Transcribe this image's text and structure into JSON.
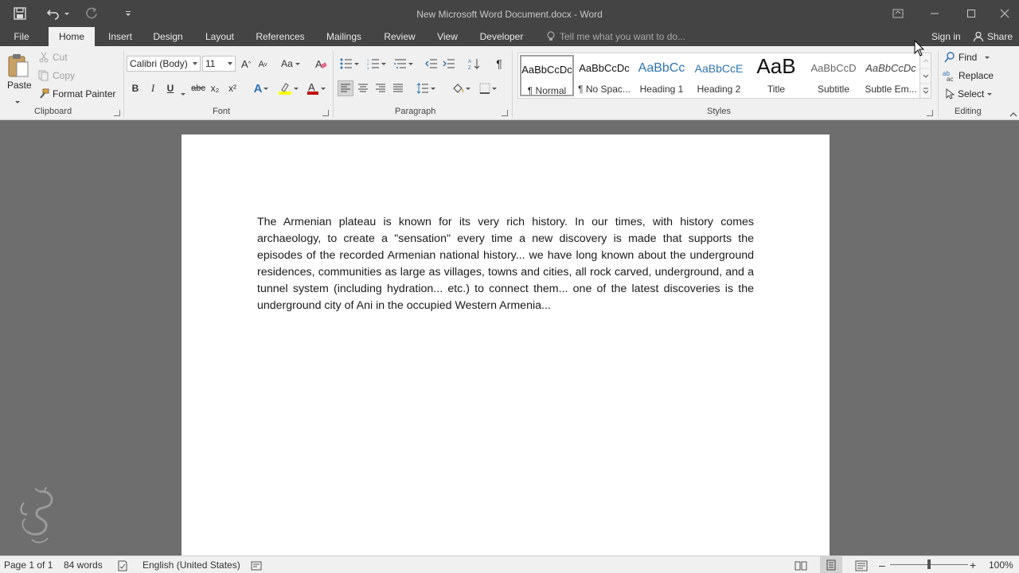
{
  "window": {
    "title": "New Microsoft Word Document.docx - Word"
  },
  "tabs": [
    {
      "label": "File"
    },
    {
      "label": "Home",
      "active": true
    },
    {
      "label": "Insert"
    },
    {
      "label": "Design"
    },
    {
      "label": "Layout"
    },
    {
      "label": "References"
    },
    {
      "label": "Mailings"
    },
    {
      "label": "Review"
    },
    {
      "label": "View"
    },
    {
      "label": "Developer"
    }
  ],
  "tell_me": {
    "placeholder": "Tell me what you want to do..."
  },
  "account": {
    "sign_in": "Sign in",
    "share": "Share"
  },
  "clipboard": {
    "paste": "Paste",
    "cut": "Cut",
    "copy": "Copy",
    "format_painter": "Format Painter",
    "group_label": "Clipboard"
  },
  "font": {
    "family": "Calibri (Body)",
    "size": "11",
    "change_case": "Aa",
    "bold": "B",
    "italic": "I",
    "underline": "U",
    "strikethrough": "abc",
    "subscript": "x₂",
    "superscript": "x²",
    "group_label": "Font"
  },
  "paragraph": {
    "group_label": "Paragraph",
    "show_marks": "¶"
  },
  "styles": {
    "group_label": "Styles",
    "items": [
      {
        "preview": "AaBbCcDc",
        "name": "¶ Normal"
      },
      {
        "preview": "AaBbCcDc",
        "name": "¶ No Spac..."
      },
      {
        "preview": "AaBbCc",
        "name": "Heading 1"
      },
      {
        "preview": "AaBbCcE",
        "name": "Heading 2"
      },
      {
        "preview": "AaB",
        "name": "Title"
      },
      {
        "preview": "AaBbCcD",
        "name": "Subtitle"
      },
      {
        "preview": "AaBbCcDc",
        "name": "Subtle Em..."
      }
    ]
  },
  "editing": {
    "find": "Find",
    "replace": "Replace",
    "select": "Select",
    "group_label": "Editing"
  },
  "document": {
    "body": "The Armenian plateau is known for its very rich history. In our times, with history comes archaeology, to create a \"sensation\" every time a new discovery is made that supports the episodes of the recorded Armenian national history... we have long known about the underground residences, communities as large as villages, towns and cities, all rock carved, underground, and a tunnel system (including hydration... etc.) to connect them... one of the latest discoveries is the underground city of Ani in the occupied Western Armenia..."
  },
  "status": {
    "page": "Page 1 of 1",
    "words": "84 words",
    "language": "English (United States)",
    "zoom": "100%",
    "zoom_fraction": 0.5
  },
  "colors": {
    "titlebar": "#444444",
    "ribbon": "#f0f0f0",
    "canvas": "#6e6e6e",
    "highlight": "#ffff00",
    "font_color": "#c00000",
    "heading_blue": "#2e74b5"
  }
}
